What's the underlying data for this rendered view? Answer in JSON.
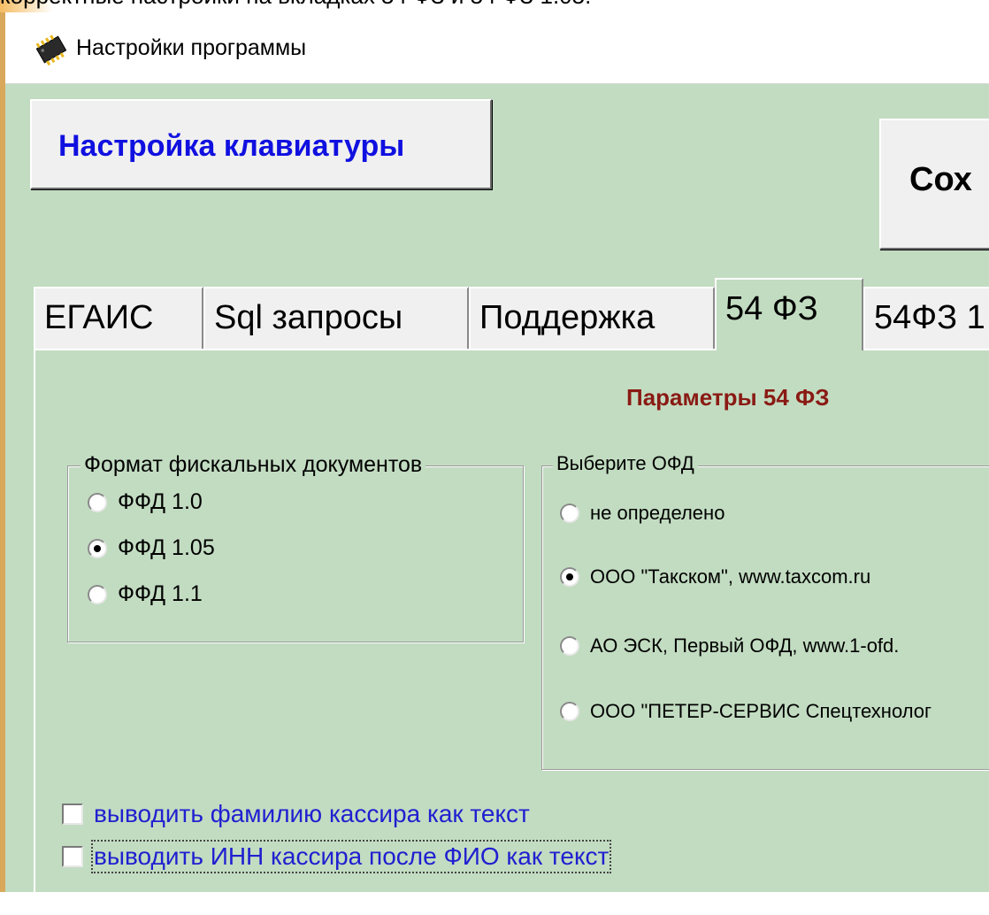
{
  "top_caption": "корректные настройки на вкладках 54 ФЗ и 54 ФЗ 1.05.",
  "window": {
    "title": "Настройки программы"
  },
  "buttons": {
    "keyboard": "Настройка клавиатуры",
    "save": "Сох"
  },
  "tabs": [
    {
      "label": "ЕГАИС",
      "active": false
    },
    {
      "label": "Sql запросы",
      "active": false
    },
    {
      "label": "Поддержка",
      "active": false
    },
    {
      "label": "54 ФЗ",
      "active": true
    },
    {
      "label": "54ФЗ 1",
      "active": false
    }
  ],
  "panel": {
    "title": "Параметры 54 ФЗ",
    "format_group": {
      "legend": "Формат фискальных документов",
      "options": [
        {
          "label": "ФФД 1.0",
          "selected": false
        },
        {
          "label": "ФФД 1.05",
          "selected": true
        },
        {
          "label": "ФФД 1.1",
          "selected": false
        }
      ]
    },
    "ofd_group": {
      "legend": "Выберите ОФД",
      "options": [
        {
          "label": "не определено",
          "selected": false
        },
        {
          "label": "ООО \"Такском\", www.taxcom.ru",
          "selected": true
        },
        {
          "label": "АО ЭСК, Первый ОФД, www.1-ofd.",
          "selected": false
        },
        {
          "label": "ООО \"ПЕТЕР-СЕРВИС Спецтехнолог",
          "selected": false
        }
      ]
    },
    "checkboxes": [
      {
        "label": "выводить фамилию кассира как текст",
        "checked": false
      },
      {
        "label": "выводить ИНН кассира после ФИО как текст",
        "checked": false
      }
    ]
  },
  "colors": {
    "window_bg": "#c2dcc1",
    "panel_title": "#8a1a14",
    "link_blue": "#2020d0",
    "keyboard_button_text": "#1010e0"
  },
  "icons": {
    "app": "microchip-icon"
  }
}
